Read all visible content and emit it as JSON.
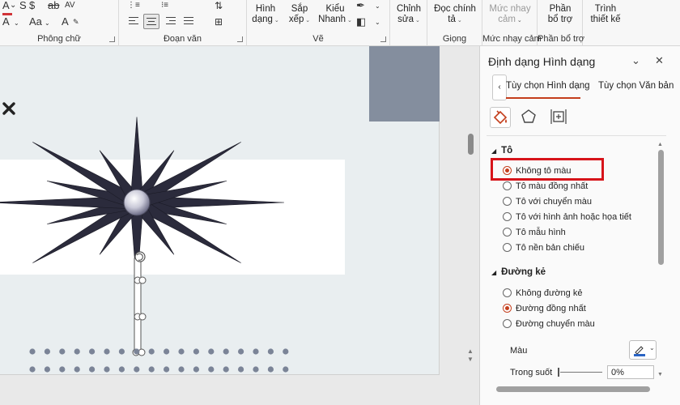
{
  "ribbon": {
    "font_group_label": "Phông chữ",
    "paragraph_group_label": "Đoạn văn",
    "draw_group": {
      "label": "Vẽ",
      "shapes_line1": "Hình",
      "shapes_line2": "dạng",
      "arrange_line1": "Sắp",
      "arrange_line2": "xếp",
      "quick_styles_line1": "Kiểu",
      "quick_styles_line2": "Nhanh"
    },
    "edit_line1": "Chỉnh",
    "edit_line2": "sửa",
    "voice_group": {
      "label": "Giọng",
      "dictate_line1": "Đọc chính",
      "dictate_line2": "tả"
    },
    "sensitivity_group": {
      "label": "Mức nhạy cảm",
      "btn_line1": "Mức nhay",
      "btn_line2": "cảm"
    },
    "addins_group": {
      "label": "Phần bổ trợ",
      "btn_line1": "Phần",
      "btn_line2": "bổ trợ"
    },
    "designer_line1": "Trình",
    "designer_line2": "thiết kế"
  },
  "pane": {
    "title": "Định dạng Hình dạng",
    "tabs": [
      "Tùy chọn Hình dạng",
      "Tùy chọn Văn bản"
    ],
    "fill_section": {
      "title": "Tô",
      "options": [
        {
          "label": "Không tô màu",
          "selected": true
        },
        {
          "label": "Tô màu đồng nhất",
          "selected": false
        },
        {
          "label": "Tô với chuyển màu",
          "selected": false
        },
        {
          "label": "Tô với hình ảnh hoặc họa tiết",
          "selected": false
        },
        {
          "label": "Tô mẫu hình",
          "selected": false
        },
        {
          "label": "Tô nền bản chiếu",
          "selected": false
        }
      ]
    },
    "line_section": {
      "title": "Đường kẻ",
      "options": [
        {
          "label": "Không đường kẻ",
          "selected": false
        },
        {
          "label": "Đường đồng nhất",
          "selected": true
        },
        {
          "label": "Đường chuyển màu",
          "selected": false
        }
      ],
      "color_label": "Màu",
      "transparency_label": "Trong suốt",
      "transparency_value": "0%"
    }
  },
  "colors": {
    "accent": "#c43e1c",
    "highlight": "#d7141a",
    "star_fill": "#2b2b3c",
    "dots": "#7b8497"
  }
}
